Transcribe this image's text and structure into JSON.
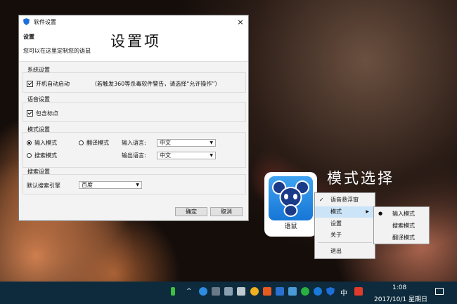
{
  "dialog": {
    "title": "软件设置",
    "close": "×",
    "header_title": "设置",
    "header_subtitle": "您可以在这里定制您的语鼠",
    "annotation": "设置项",
    "system": {
      "title": "系统设置",
      "autostart": "开机自动启动",
      "note": "（若触发360等杀毒软件警告，请选择“允许操作”）"
    },
    "voice": {
      "title": "语音设置",
      "punct": "包含标点"
    },
    "mode": {
      "title": "模式设置",
      "input_mode": "输入模式",
      "translate_mode": "翻译模式",
      "search_mode": "搜索模式",
      "input_lang_label": "输入语言:",
      "input_lang_value": "中文",
      "output_lang_label": "输出语言:",
      "output_lang_value": "中文"
    },
    "search": {
      "title": "搜索设置",
      "engine_label": "默认搜索引擎",
      "engine_value": "百度"
    },
    "ok": "确定",
    "cancel": "取消"
  },
  "app": {
    "label": "语鼠"
  },
  "annotation2": "模式选择",
  "menu": {
    "items": [
      "语音悬浮窗",
      "模式",
      "设置",
      "关于",
      "退出"
    ],
    "check": "✓",
    "arrow": "▶",
    "submenu": [
      "输入模式",
      "搜索模式",
      "翻译模式"
    ],
    "dot": "●"
  },
  "taskbar": {
    "ime": "中",
    "time": "1:08",
    "date": "2017/10/1 星期日",
    "chevron": "^"
  }
}
